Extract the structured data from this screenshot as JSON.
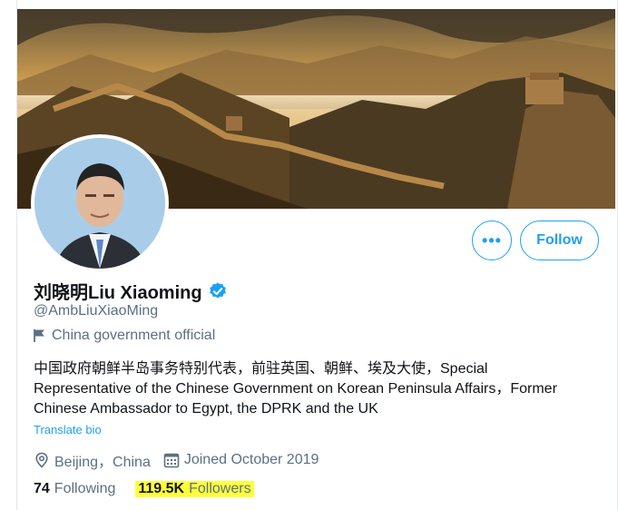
{
  "profile": {
    "display_name": "刘晓明Liu Xiaoming",
    "handle": "@AmbLiuXiaoMing",
    "label": "China government official",
    "bio": "中国政府朝鲜半岛事务特别代表，前驻英国、朝鲜、埃及大使，Special Representative of the Chinese Government on Korean Peninsula Affairs，Former Chinese Ambassador to Egypt, the DPRK and the UK",
    "translate_label": "Translate bio",
    "location": "Beijing，China",
    "joined": "Joined October 2019",
    "following_count": "74",
    "following_label": "Following",
    "followers_count": "119.5K",
    "followers_label": "Followers"
  },
  "actions": {
    "more_label": "•••",
    "follow_label": "Follow"
  },
  "icons": {
    "verified": "verified-badge-icon",
    "label": "flag-icon",
    "location": "location-pin-icon",
    "joined": "calendar-icon",
    "more": "more-dots-icon"
  },
  "colors": {
    "accent": "#1da1f2",
    "secondary_text": "#5b7083",
    "highlight": "#ffff3d"
  }
}
